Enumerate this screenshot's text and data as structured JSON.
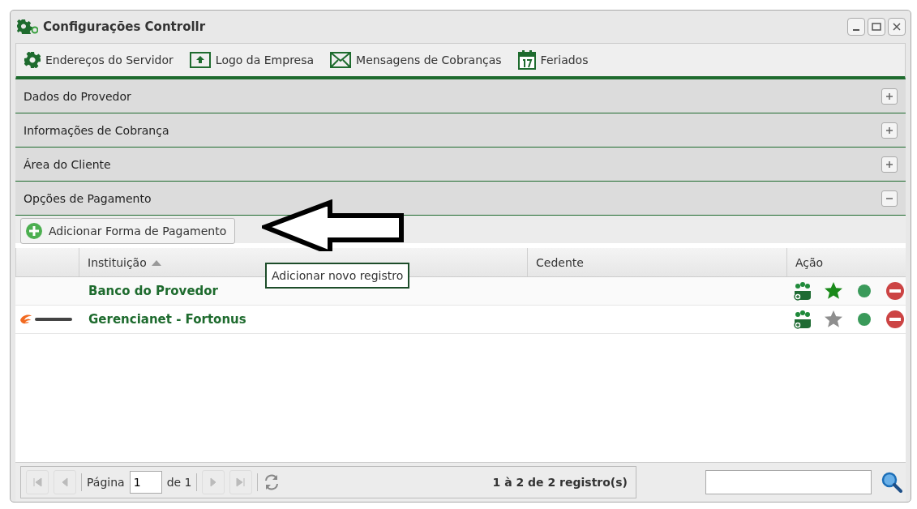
{
  "window": {
    "title": "Configurações Controllr"
  },
  "toolbar": [
    {
      "label": "Endereços do Servidor",
      "kind": "gear"
    },
    {
      "label": "Logo da Empresa",
      "kind": "upload"
    },
    {
      "label": "Mensagens de Cobranças",
      "kind": "mail"
    },
    {
      "label": "Feriados",
      "kind": "calendar"
    }
  ],
  "panels": [
    {
      "title": "Dados do Provedor",
      "expanded": false
    },
    {
      "title": "Informações de Cobrança",
      "expanded": false
    },
    {
      "title": "Área do Cliente",
      "expanded": false
    },
    {
      "title": "Opções de Pagamento",
      "expanded": true
    }
  ],
  "payment": {
    "add_button": "Adicionar Forma de Pagamento",
    "tooltip": "Adicionar novo registro",
    "columns": [
      {
        "label": "Instituição",
        "sorted": true
      },
      {
        "label": "Cedente",
        "sorted": false
      },
      {
        "label": "Ação",
        "sorted": false
      }
    ],
    "rows": [
      {
        "institution": "Banco do Provedor",
        "logo": false,
        "default": true,
        "active": true
      },
      {
        "institution": "Gerencianet - Fortonus",
        "logo": true,
        "default": false,
        "active": true
      }
    ]
  },
  "paging": {
    "page_label": "Página",
    "page": "1",
    "of": "de 1",
    "summary": "1 à 2 de 2 registro(s)"
  }
}
